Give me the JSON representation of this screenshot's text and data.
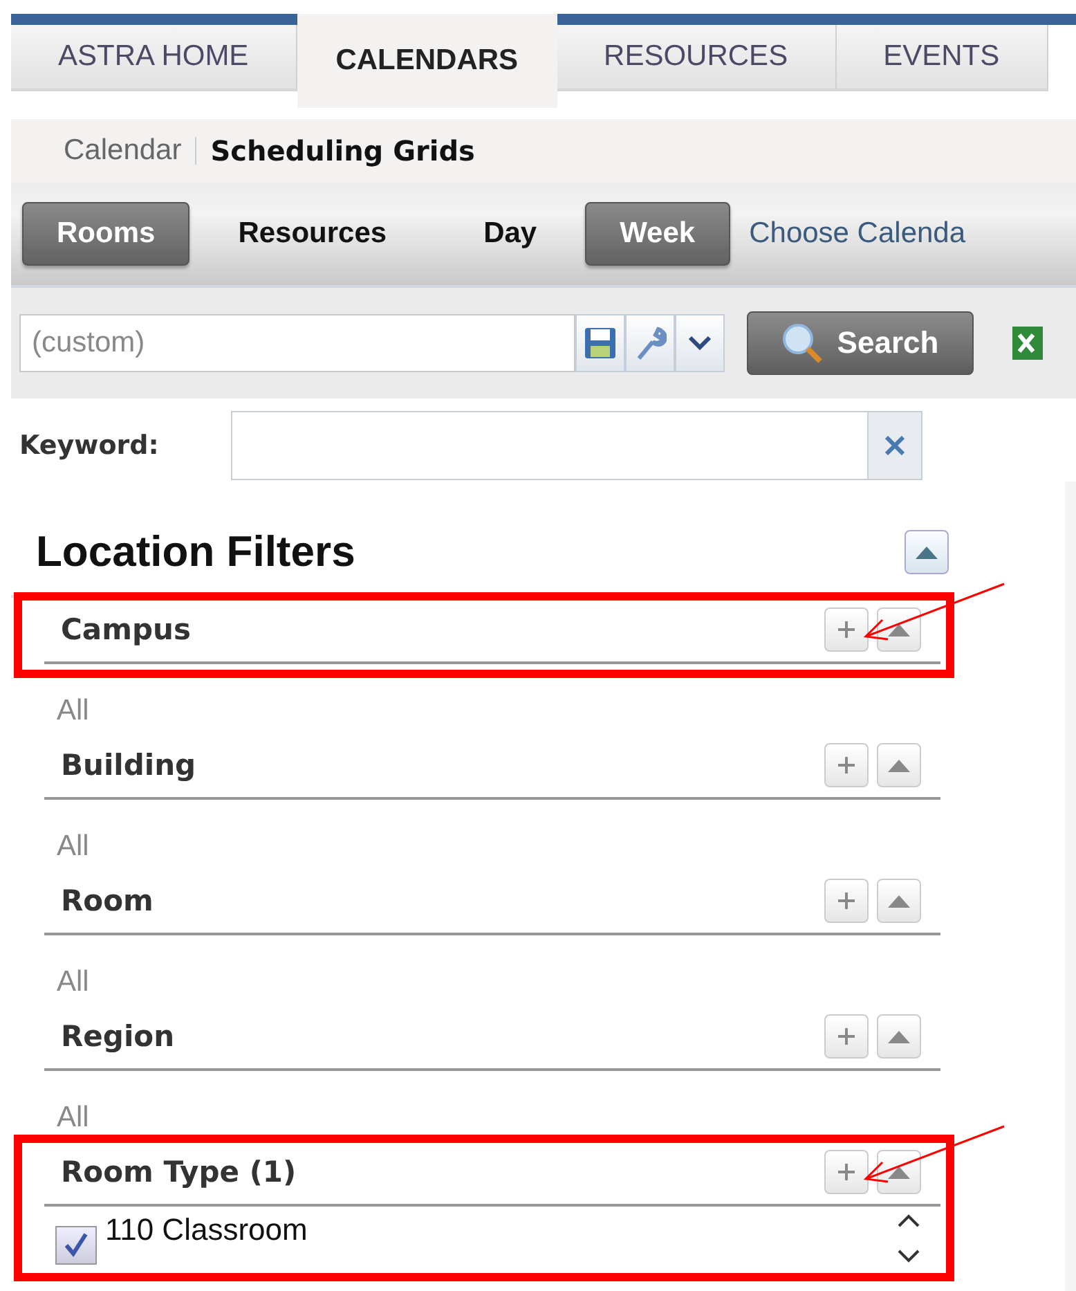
{
  "tabs": [
    {
      "label": "ASTRA HOME",
      "selected": false
    },
    {
      "label": "CALENDARS",
      "selected": true
    },
    {
      "label": "RESOURCES",
      "selected": false
    },
    {
      "label": "EVENTS",
      "selected": false
    }
  ],
  "breadcrumb": [
    {
      "label": "Calendar",
      "selected": false
    },
    {
      "label": "Scheduling Grids",
      "selected": true
    }
  ],
  "toolbar": [
    {
      "kind": "toggle",
      "label": "Rooms",
      "selected": true
    },
    {
      "kind": "toggle",
      "label": "Resources",
      "selected": false
    },
    {
      "kind": "toggle",
      "label": "Day",
      "selected": false
    },
    {
      "kind": "toggle",
      "label": "Week",
      "selected": true
    },
    {
      "kind": "link",
      "label": "Choose Calenda"
    }
  ],
  "saved_search": {
    "value": "(custom)"
  },
  "search_button": "Search",
  "keyword": {
    "label": "Keyword:"
  },
  "filters_panel": {
    "title": "Location Filters",
    "filters": [
      {
        "title": "Campus",
        "value": "All",
        "highlighted": true
      },
      {
        "title": "Building",
        "value": "All",
        "highlighted": false
      },
      {
        "title": "Room",
        "value": "All",
        "highlighted": false
      },
      {
        "title": "Region",
        "value": "All",
        "highlighted": false
      },
      {
        "title": "Room Type (1)",
        "highlighted": true,
        "options": [
          {
            "label": "110 Classroom",
            "checked": true
          }
        ]
      }
    ]
  }
}
